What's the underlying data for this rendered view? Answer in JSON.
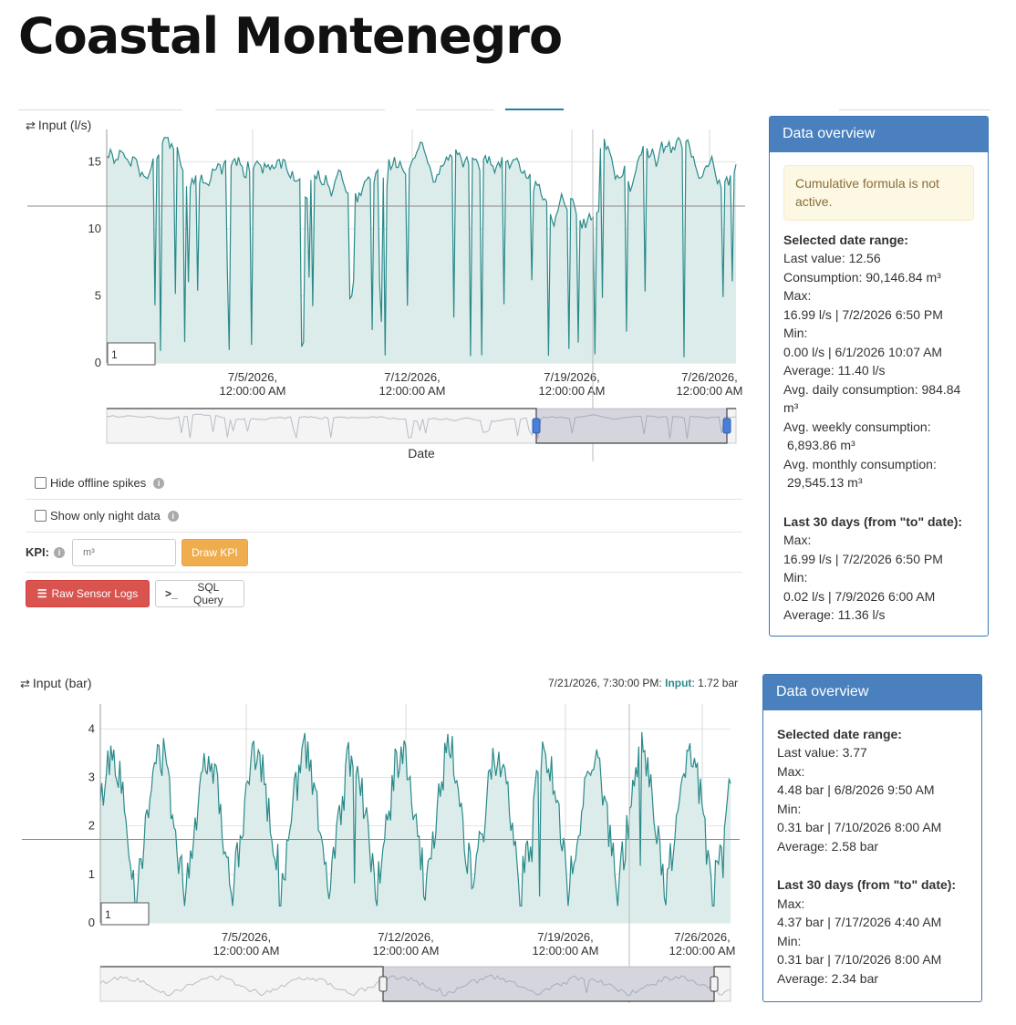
{
  "page": {
    "title": "Coastal Montenegro"
  },
  "flow_chart": {
    "label": "Input (l/s)",
    "icon": "swap-arrows-icon",
    "range_box_value": "1",
    "navigator_label": "Date",
    "chart_data": {
      "type": "area",
      "title": "",
      "ylabel": "Input (l/s)",
      "xlabel": "Date",
      "ylim": [
        0,
        17
      ],
      "yticks": [
        0,
        5,
        10,
        15
      ],
      "xtick_labels": [
        [
          "7/5/2026,",
          "12:00:00 AM"
        ],
        [
          "7/12/2026,",
          "12:00:00 AM"
        ],
        [
          "7/19/2026,",
          "12:00:00 AM"
        ],
        [
          "7/26/2026,",
          "12:00:00 AM"
        ]
      ],
      "x_range": [
        "6/29/2026",
        "7/28/2026"
      ],
      "baseline_level": 11.7,
      "series": [
        {
          "name": "Input",
          "color": "#2a8a8a",
          "fill": "#dcecea"
        }
      ]
    }
  },
  "flow_overview": {
    "title": "Data overview",
    "alert": "Cumulative formula is not active.",
    "selected_heading": "Selected date range:",
    "selected": [
      "Last value: 12.56",
      "Consumption: 90,146.84 m³",
      "Max:",
      "16.99 l/s | 7/2/2026 6:50 PM",
      "Min:",
      "0.00 l/s | 6/1/2026 10:07 AM",
      "Average: 11.40 l/s",
      "Avg. daily consumption:  984.84",
      "m³",
      "Avg. weekly consumption:",
      " 6,893.86 m³",
      "Avg. monthly consumption:",
      " 29,545.13 m³"
    ],
    "last30_heading": "Last 30 days (from \"to\" date):",
    "last30": [
      "Max:",
      "16.99 l/s | 7/2/2026 6:50 PM",
      "Min:",
      "0.02 l/s | 7/9/2026 6:00 AM",
      "Average: 11.36 l/s"
    ]
  },
  "controls": {
    "hide_spikes": "Hide offline spikes",
    "night_data": "Show only night data",
    "kpi_label": "KPI:",
    "kpi_placeholder": "m³",
    "draw_kpi": "Draw KPI",
    "raw_logs": "Raw Sensor Logs",
    "sql_query": "SQL Query"
  },
  "pressure_chart": {
    "label": "Input (bar)",
    "icon": "swap-arrows-icon",
    "range_box_value": "1",
    "hover_time": "7/21/2026, 7:30:00 PM:",
    "hover_series": "Input",
    "hover_value": ": 1.72 bar",
    "chart_data": {
      "type": "area",
      "title": "",
      "ylabel": "Input (bar)",
      "ylim": [
        0,
        4.4
      ],
      "yticks": [
        0,
        1,
        2,
        3,
        4
      ],
      "xtick_labels": [
        [
          "7/5/2026,",
          "12:00:00 AM"
        ],
        [
          "7/12/2026,",
          "12:00:00 AM"
        ],
        [
          "7/19/2026,",
          "12:00:00 AM"
        ],
        [
          "7/26/2026,",
          "12:00:00 AM"
        ]
      ],
      "x_range": [
        "6/29/2026",
        "7/28/2026"
      ],
      "baseline_level": 1.72,
      "series": [
        {
          "name": "Input",
          "color": "#2a8a8a",
          "fill": "#dcecea"
        }
      ]
    }
  },
  "pressure_overview": {
    "title": "Data overview",
    "selected_heading": "Selected date range:",
    "selected": [
      "Last value: 3.77",
      "Max:",
      "4.48 bar | 6/8/2026 9:50 AM",
      "Min:",
      "0.31 bar | 7/10/2026 8:00 AM",
      "Average: 2.58 bar"
    ],
    "last30_heading": "Last 30 days (from \"to\" date):",
    "last30": [
      "Max:",
      "4.37 bar | 7/17/2026 4:40 AM",
      "Min:",
      "0.31 bar | 7/10/2026 8:00 AM",
      "Average: 2.34 bar"
    ]
  }
}
